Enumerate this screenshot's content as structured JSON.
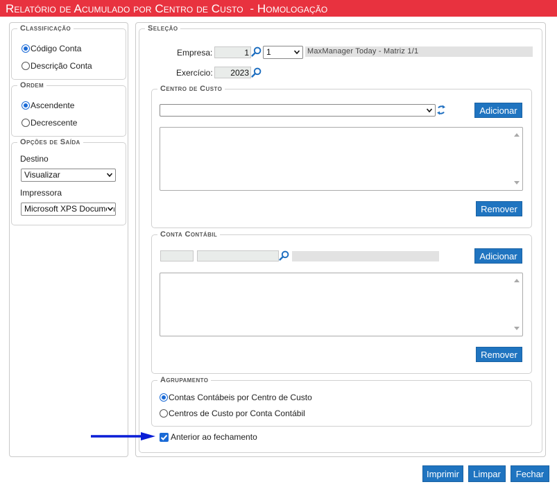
{
  "title": "Relatório de Acumulado por Centro de Custo  - Homologação",
  "left": {
    "classificacao": {
      "legend": "Classificação",
      "options": [
        "Código Conta",
        "Descrição Conta"
      ],
      "selected": 0
    },
    "ordem": {
      "legend": "Ordem",
      "options": [
        "Ascendente",
        "Decrescente"
      ],
      "selected": 0
    },
    "saida": {
      "legend": "Opções de Saída",
      "destino_label": "Destino",
      "destino_value": "Visualizar",
      "impressora_label": "Impressora",
      "impressora_value": "Microsoft XPS Document Writer"
    }
  },
  "selecao": {
    "legend": "Seleção",
    "empresa_label": "Empresa:",
    "empresa_code": "1",
    "empresa_select": "1",
    "empresa_name": "MaxManager Today - Matriz 1/1",
    "exercicio_label": "Exercício:",
    "exercicio_value": "2023"
  },
  "centro_custo": {
    "legend": "Centro de Custo",
    "select_value": "",
    "add_label": "Adicionar",
    "remove_label": "Remover"
  },
  "conta_contabil": {
    "legend": "Conta Contábil",
    "add_label": "Adicionar",
    "remove_label": "Remover"
  },
  "agrupamento": {
    "legend": "Agrupamento",
    "options": [
      "Contas Contábeis por Centro de Custo",
      "Centros de Custo por Conta Contábil"
    ],
    "selected": 0
  },
  "anterior_fechamento": {
    "label": "Anterior ao fechamento",
    "checked": true
  },
  "footer": {
    "imprimir": "Imprimir",
    "limpar": "Limpar",
    "fechar": "Fechar"
  },
  "colors": {
    "title_bg": "#e8323f",
    "button": "#1f74c0",
    "accent": "#1a6ad6",
    "arrow": "#0a1ed6"
  },
  "icons": [
    "search-icon",
    "refresh-icon",
    "chevron-down-icon",
    "checkmark-icon",
    "arrow-right-icon"
  ]
}
